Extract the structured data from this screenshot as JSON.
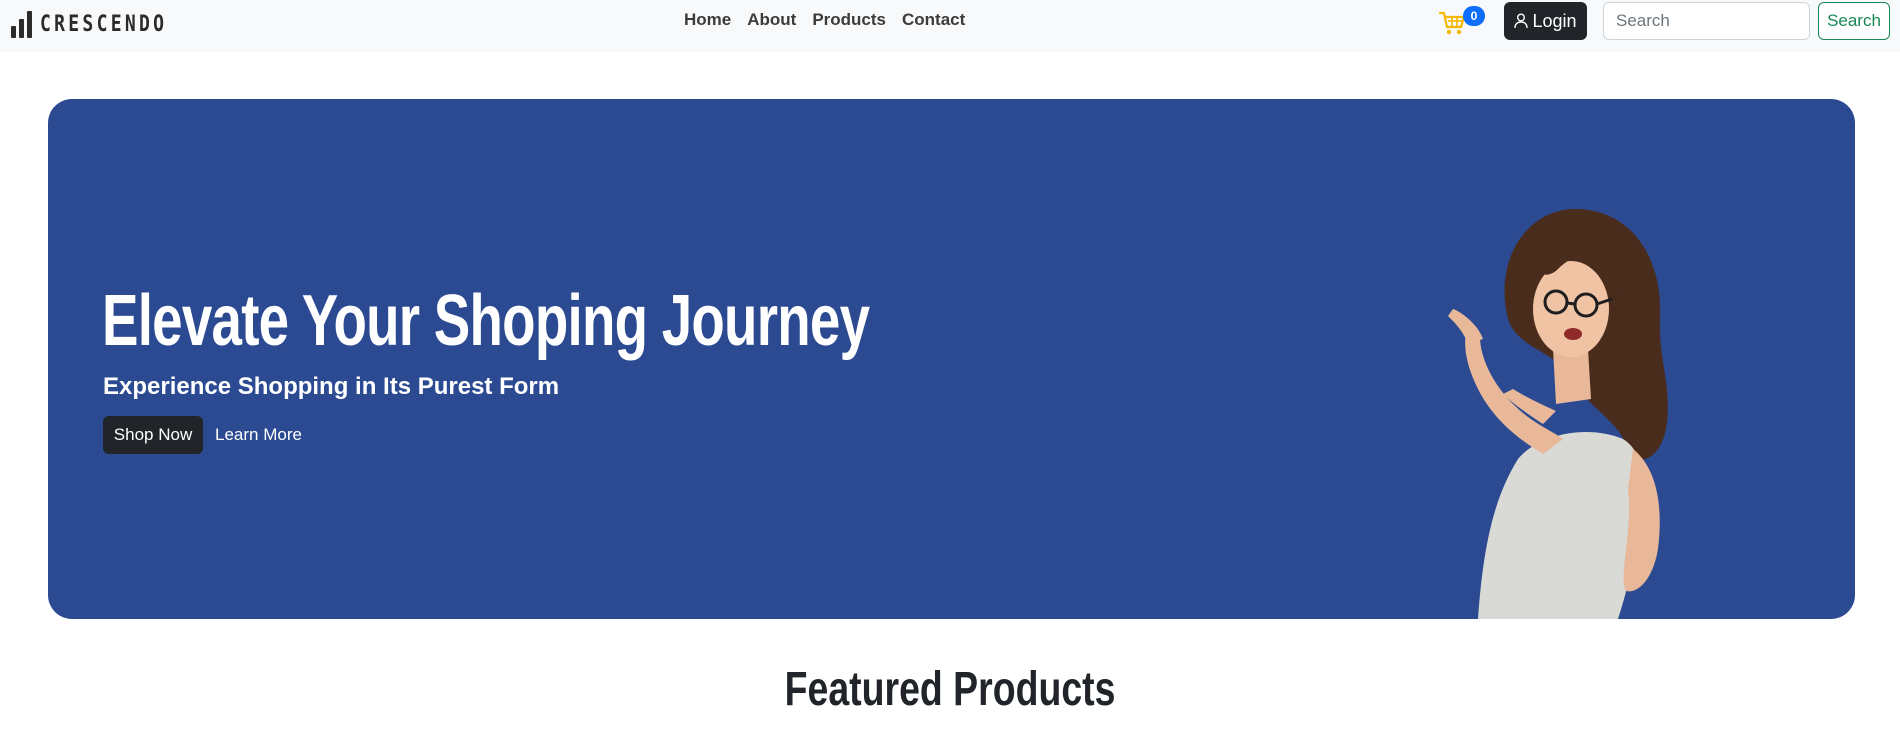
{
  "brand": {
    "name": "CRESCENDO"
  },
  "nav": {
    "links": [
      {
        "label": "Home"
      },
      {
        "label": "About"
      },
      {
        "label": "Products"
      },
      {
        "label": "Contact"
      }
    ]
  },
  "cart": {
    "icon": "cart-icon",
    "count": "0"
  },
  "login": {
    "label": "Login",
    "icon": "user-icon"
  },
  "search": {
    "placeholder": "Search",
    "value": "",
    "button_label": "Search"
  },
  "hero": {
    "title": "Elevate Your Shoping Journey",
    "subtitle": "Experience Shopping in Its Purest Form",
    "primary_button": "Shop Now",
    "secondary_link": "Learn More",
    "background_color": "#2b4a92"
  },
  "featured": {
    "title": "Featured Products"
  },
  "colors": {
    "navbar_bg": "#f8f9fa",
    "dark_button": "#212529",
    "badge": "#0d6efd",
    "search_outline": "#198754",
    "cart": "#f5b800"
  }
}
